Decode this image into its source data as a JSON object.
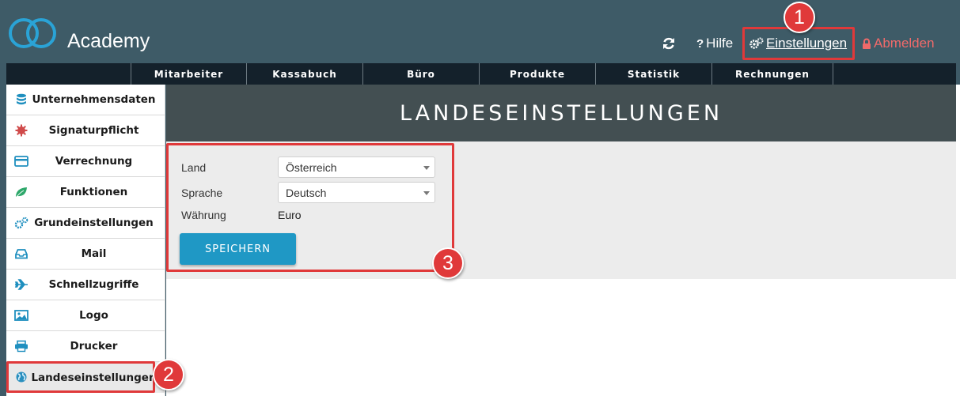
{
  "header": {
    "app_title": "Academy",
    "help_label": "Hilfe",
    "settings_label": "Einstellungen",
    "logout_label": "Abmelden",
    "logout_color": "#f06a6a"
  },
  "nav": {
    "items": [
      "Mitarbeiter",
      "Kassabuch",
      "Büro",
      "Produkte",
      "Statistik",
      "Rechnungen"
    ]
  },
  "sidebar": {
    "items": [
      {
        "label": "Unternehmensdaten",
        "icon": "database-icon"
      },
      {
        "label": "Signaturpflicht",
        "icon": "seal-icon"
      },
      {
        "label": "Verrechnung",
        "icon": "credit-card-icon"
      },
      {
        "label": "Funktionen",
        "icon": "leaf-icon"
      },
      {
        "label": "Grundeinstellungen",
        "icon": "gears-icon"
      },
      {
        "label": "Mail",
        "icon": "inbox-icon"
      },
      {
        "label": "Schnellzugriffe",
        "icon": "plane-icon"
      },
      {
        "label": "Logo",
        "icon": "image-icon"
      },
      {
        "label": "Drucker",
        "icon": "printer-icon"
      },
      {
        "label": "Landeseinstellungen",
        "icon": "globe-icon",
        "active": true
      }
    ]
  },
  "page": {
    "title": "LANDESEINSTELLUNGEN"
  },
  "form": {
    "country_label": "Land",
    "country_value": "Österreich",
    "language_label": "Sprache",
    "language_value": "Deutsch",
    "currency_label": "Währung",
    "currency_value": "Euro",
    "save_label": "SPEICHERN"
  },
  "annotations": {
    "badge_1": "1",
    "badge_2": "2",
    "badge_3": "3",
    "highlight_color": "#e0393a"
  },
  "colors": {
    "header_bg": "#3e5b67",
    "nav_bg": "#14212b",
    "accent": "#1f98c5",
    "page_header_bg": "#434f52"
  }
}
